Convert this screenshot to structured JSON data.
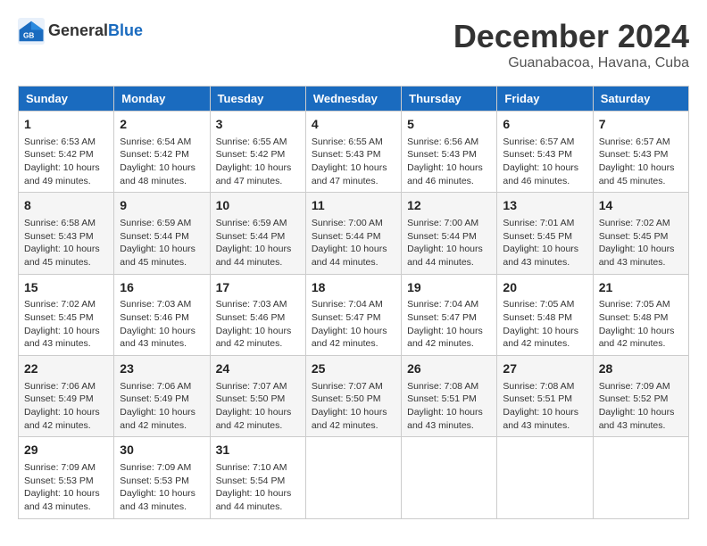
{
  "header": {
    "logo_line1": "General",
    "logo_line2": "Blue",
    "month": "December 2024",
    "location": "Guanabacoa, Havana, Cuba"
  },
  "weekdays": [
    "Sunday",
    "Monday",
    "Tuesday",
    "Wednesday",
    "Thursday",
    "Friday",
    "Saturday"
  ],
  "weeks": [
    [
      {
        "day": "1",
        "detail": "Sunrise: 6:53 AM\nSunset: 5:42 PM\nDaylight: 10 hours\nand 49 minutes."
      },
      {
        "day": "2",
        "detail": "Sunrise: 6:54 AM\nSunset: 5:42 PM\nDaylight: 10 hours\nand 48 minutes."
      },
      {
        "day": "3",
        "detail": "Sunrise: 6:55 AM\nSunset: 5:42 PM\nDaylight: 10 hours\nand 47 minutes."
      },
      {
        "day": "4",
        "detail": "Sunrise: 6:55 AM\nSunset: 5:43 PM\nDaylight: 10 hours\nand 47 minutes."
      },
      {
        "day": "5",
        "detail": "Sunrise: 6:56 AM\nSunset: 5:43 PM\nDaylight: 10 hours\nand 46 minutes."
      },
      {
        "day": "6",
        "detail": "Sunrise: 6:57 AM\nSunset: 5:43 PM\nDaylight: 10 hours\nand 46 minutes."
      },
      {
        "day": "7",
        "detail": "Sunrise: 6:57 AM\nSunset: 5:43 PM\nDaylight: 10 hours\nand 45 minutes."
      }
    ],
    [
      {
        "day": "8",
        "detail": "Sunrise: 6:58 AM\nSunset: 5:43 PM\nDaylight: 10 hours\nand 45 minutes."
      },
      {
        "day": "9",
        "detail": "Sunrise: 6:59 AM\nSunset: 5:44 PM\nDaylight: 10 hours\nand 45 minutes."
      },
      {
        "day": "10",
        "detail": "Sunrise: 6:59 AM\nSunset: 5:44 PM\nDaylight: 10 hours\nand 44 minutes."
      },
      {
        "day": "11",
        "detail": "Sunrise: 7:00 AM\nSunset: 5:44 PM\nDaylight: 10 hours\nand 44 minutes."
      },
      {
        "day": "12",
        "detail": "Sunrise: 7:00 AM\nSunset: 5:44 PM\nDaylight: 10 hours\nand 44 minutes."
      },
      {
        "day": "13",
        "detail": "Sunrise: 7:01 AM\nSunset: 5:45 PM\nDaylight: 10 hours\nand 43 minutes."
      },
      {
        "day": "14",
        "detail": "Sunrise: 7:02 AM\nSunset: 5:45 PM\nDaylight: 10 hours\nand 43 minutes."
      }
    ],
    [
      {
        "day": "15",
        "detail": "Sunrise: 7:02 AM\nSunset: 5:45 PM\nDaylight: 10 hours\nand 43 minutes."
      },
      {
        "day": "16",
        "detail": "Sunrise: 7:03 AM\nSunset: 5:46 PM\nDaylight: 10 hours\nand 43 minutes."
      },
      {
        "day": "17",
        "detail": "Sunrise: 7:03 AM\nSunset: 5:46 PM\nDaylight: 10 hours\nand 42 minutes."
      },
      {
        "day": "18",
        "detail": "Sunrise: 7:04 AM\nSunset: 5:47 PM\nDaylight: 10 hours\nand 42 minutes."
      },
      {
        "day": "19",
        "detail": "Sunrise: 7:04 AM\nSunset: 5:47 PM\nDaylight: 10 hours\nand 42 minutes."
      },
      {
        "day": "20",
        "detail": "Sunrise: 7:05 AM\nSunset: 5:48 PM\nDaylight: 10 hours\nand 42 minutes."
      },
      {
        "day": "21",
        "detail": "Sunrise: 7:05 AM\nSunset: 5:48 PM\nDaylight: 10 hours\nand 42 minutes."
      }
    ],
    [
      {
        "day": "22",
        "detail": "Sunrise: 7:06 AM\nSunset: 5:49 PM\nDaylight: 10 hours\nand 42 minutes."
      },
      {
        "day": "23",
        "detail": "Sunrise: 7:06 AM\nSunset: 5:49 PM\nDaylight: 10 hours\nand 42 minutes."
      },
      {
        "day": "24",
        "detail": "Sunrise: 7:07 AM\nSunset: 5:50 PM\nDaylight: 10 hours\nand 42 minutes."
      },
      {
        "day": "25",
        "detail": "Sunrise: 7:07 AM\nSunset: 5:50 PM\nDaylight: 10 hours\nand 42 minutes."
      },
      {
        "day": "26",
        "detail": "Sunrise: 7:08 AM\nSunset: 5:51 PM\nDaylight: 10 hours\nand 43 minutes."
      },
      {
        "day": "27",
        "detail": "Sunrise: 7:08 AM\nSunset: 5:51 PM\nDaylight: 10 hours\nand 43 minutes."
      },
      {
        "day": "28",
        "detail": "Sunrise: 7:09 AM\nSunset: 5:52 PM\nDaylight: 10 hours\nand 43 minutes."
      }
    ],
    [
      {
        "day": "29",
        "detail": "Sunrise: 7:09 AM\nSunset: 5:53 PM\nDaylight: 10 hours\nand 43 minutes."
      },
      {
        "day": "30",
        "detail": "Sunrise: 7:09 AM\nSunset: 5:53 PM\nDaylight: 10 hours\nand 43 minutes."
      },
      {
        "day": "31",
        "detail": "Sunrise: 7:10 AM\nSunset: 5:54 PM\nDaylight: 10 hours\nand 44 minutes."
      },
      null,
      null,
      null,
      null
    ]
  ]
}
